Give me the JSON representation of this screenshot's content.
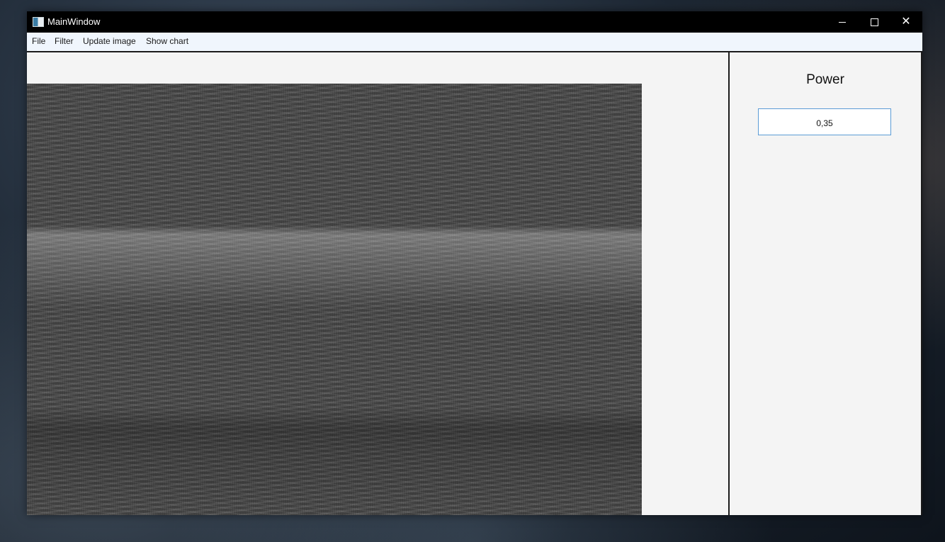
{
  "window": {
    "title": "MainWindow",
    "controls": [
      "minimize-icon",
      "maximize-icon",
      "close-icon"
    ],
    "close_glyph": "✕"
  },
  "menu": {
    "items": [
      {
        "label": "File"
      },
      {
        "label": "Filter"
      },
      {
        "label": "Update image"
      },
      {
        "label": "Show chart"
      }
    ]
  },
  "right_panel": {
    "power_label": "Power",
    "power_value": "0,35"
  },
  "colors": {
    "titlebar": "#000000",
    "menubar": "#f0f6fd",
    "input_border": "#5b9bd5"
  }
}
